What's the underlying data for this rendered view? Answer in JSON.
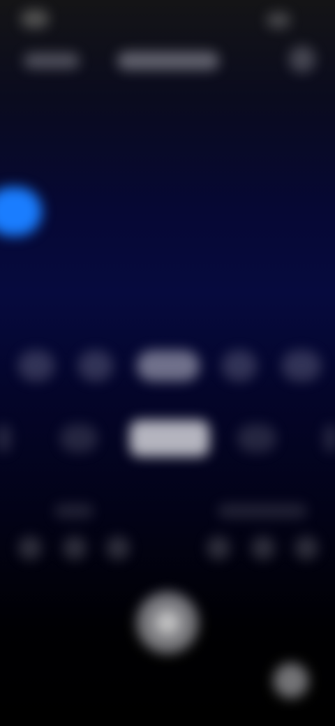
{
  "header": {
    "left_label": "",
    "title": ""
  },
  "zoom": {
    "options": [
      "",
      "",
      "",
      "",
      ""
    ],
    "selected_index": 2
  },
  "modes": {
    "items": [
      "",
      "",
      "",
      "",
      "",
      ""
    ],
    "selected_index": 2
  },
  "labels": {
    "left": "",
    "right": ""
  },
  "colors": {
    "accent_blue": "#1a7dff",
    "background_top": "#141416",
    "background_mid": "#060a3e",
    "background_bottom": "#000000"
  },
  "icons": {
    "status_time": "status-time-blur",
    "battery": "battery-icon",
    "settings": "gear-icon",
    "shutter": "shutter-icon",
    "corner": "circle-button-icon"
  }
}
